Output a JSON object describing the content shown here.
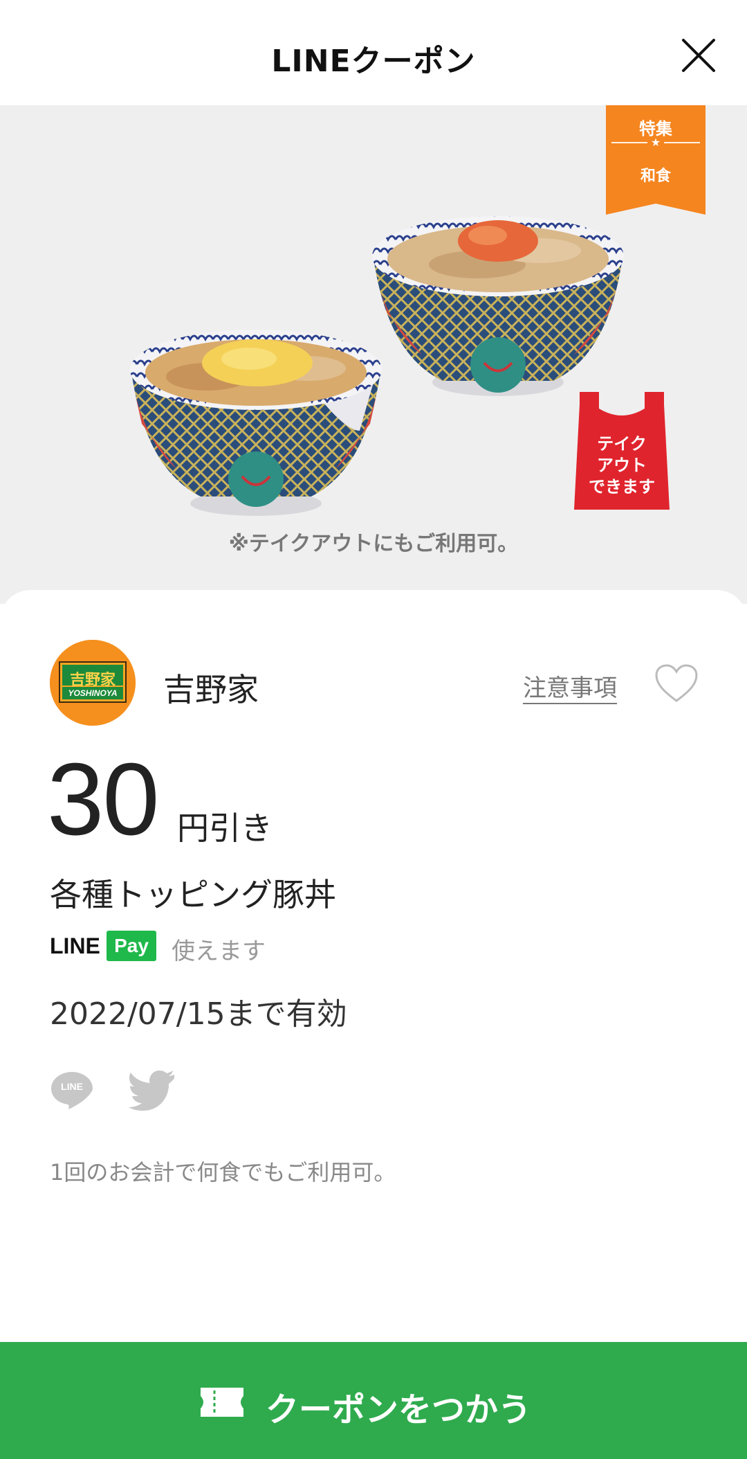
{
  "header": {
    "title": "LINEクーポン"
  },
  "hero": {
    "ribbon": {
      "top": "特集",
      "star": "★",
      "bottom": "和食",
      "color": "#f5851f"
    },
    "takeout_badge": {
      "lines": [
        "テイク",
        "アウト",
        "できます"
      ],
      "color": "#e0242d"
    },
    "note": "※テイクアウトにもご利用可。"
  },
  "shop": {
    "name": "吉野家",
    "logo_text_main": "吉野家",
    "logo_text_sub": "YOSHINOYA",
    "notes_label": "注意事項",
    "favorite_icon": "heart-outline-icon"
  },
  "coupon": {
    "discount_value": "30",
    "discount_unit": "円引き",
    "product": "各種トッピング豚丼",
    "linepay": {
      "line_text": "LINE",
      "pay_text": "Pay",
      "status": "使えます"
    },
    "expiry": "2022/07/15まで有効",
    "usage_note": "1回のお会計で何食でもご利用可。"
  },
  "share": {
    "line_icon_text": "LINE"
  },
  "action": {
    "label": "クーポンをつかう",
    "color": "#2fab4e"
  }
}
